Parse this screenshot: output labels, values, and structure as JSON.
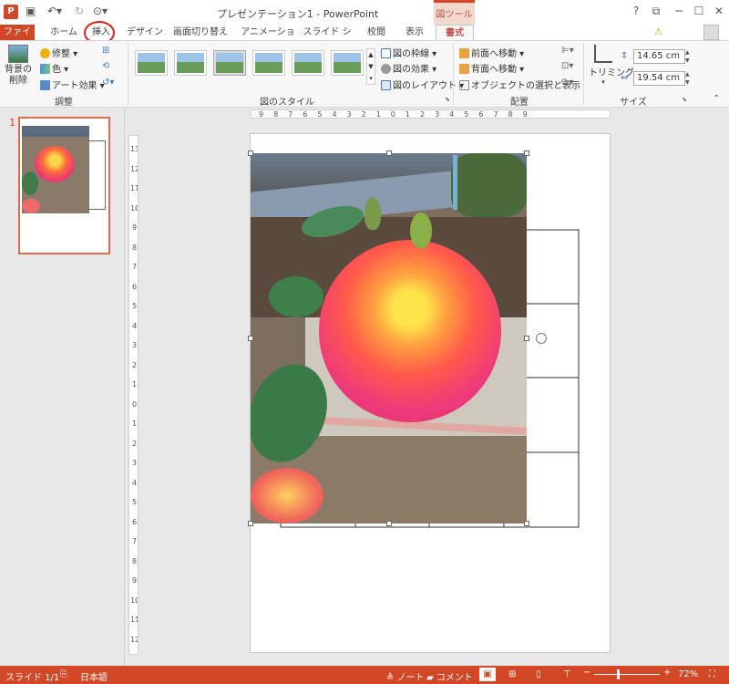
{
  "title": "プレゼンテーション1 - PowerPoint",
  "context_tab": "図ツール",
  "help": "?",
  "tabs": [
    {
      "label": "ファイル",
      "active": false
    },
    {
      "label": "ホーム",
      "active": false
    },
    {
      "label": "挿入",
      "active": false
    },
    {
      "label": "デザイン",
      "active": false
    },
    {
      "label": "画面切り替え",
      "active": false
    },
    {
      "label": "アニメーション",
      "active": false
    },
    {
      "label": "スライド ショー",
      "active": false
    },
    {
      "label": "校閲",
      "active": false
    },
    {
      "label": "表示",
      "active": false
    },
    {
      "label": "書式",
      "active": true
    }
  ],
  "ribbon": {
    "remove_bg_line1": "背景の",
    "remove_bg_line2": "削除",
    "corrections": "修整",
    "color": "色",
    "art_effects": "アート効果",
    "adjust_group": "調整",
    "picture_border": "図の枠線",
    "picture_effects": "図の効果",
    "picture_layout": "図のレイアウト",
    "styles_group": "図のスタイル",
    "bring_forward": "前面へ移動",
    "send_backward": "背面へ移動",
    "selection_pane": "オブジェクトの選択と表示",
    "arrange_group": "配置",
    "crop": "トリミング",
    "height": "14.65 cm",
    "width": "19.54 cm",
    "size_group": "サイズ"
  },
  "slides_panel": {
    "number": "1"
  },
  "status": {
    "slide": "スライド 1/1",
    "language": "日本語",
    "notes": "ノート",
    "comments": "コメント",
    "zoom": "72%"
  },
  "colors": {
    "accent": "#d24726",
    "tab_active": "#c0504d"
  }
}
